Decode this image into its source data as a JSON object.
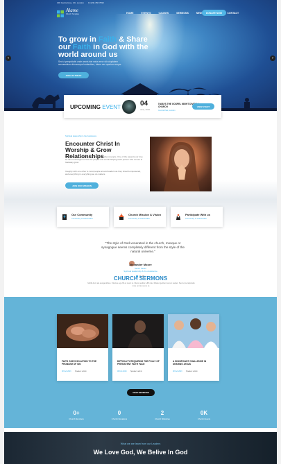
{
  "topbar": {
    "address": "400 Central Ave, UK, London",
    "phone": "0 (123) 456 7890",
    "social": [
      "f",
      "t",
      "in",
      "g"
    ]
  },
  "logo": {
    "title": "Alame",
    "subtitle": "Church Template"
  },
  "nav": {
    "items": [
      "HOME",
      "EVENTS",
      "CAUSES",
      "SERMONS",
      "NEWS",
      "PAGES",
      "CONTACT"
    ],
    "cta": "DONATE NOW"
  },
  "hero": {
    "title_1": "To grow in",
    "title_hl1": "Faith",
    "title_2": "& Share",
    "title_3": "our",
    "title_hl2": "Faith",
    "title_4": "in God with the world around us",
    "text": "Sed ut perspiciatis unde omnis iste natus error sit voluptatem accusantium doloremque laudantium, totam rem aperiam eaque.",
    "button": "JOIN US TODAY"
  },
  "event": {
    "label_bold": "UPCOMING",
    "label_thin": "EVENT",
    "day": "04",
    "month": "June, 2023",
    "title": "5 WAYS THE GOSPEL MIGHT DIVIDE A CHURCH",
    "location": "Central Park, London",
    "button": "VIEW EVENT"
  },
  "encounter": {
    "small": "Spiritual leadership & the Assistance",
    "title": "Encounter Christ In Worship & Grow Relationships",
    "p1": "We're all about people because God is all about people. One of the aspects our love for Him is through our love for people and words helping each person who comes to Gateway grow.",
    "p2": "Integrity with one other is most people around leaders as they should empowered, and everything in everything we do matters.",
    "button": "JOIN OUR MISSION"
  },
  "features": [
    {
      "title": "Our Community",
      "link": "Community of Lead Follow"
    },
    {
      "title": "Church Mission & Vision",
      "link": "Community of Lead Follow"
    },
    {
      "title": "Participate With us",
      "link": "Community of Lead Follow"
    }
  ],
  "quote": {
    "text": "\"The style of God venerated in the church, mosque or synagogue seems completely different from the style of the natural universe.\"",
    "name": "Alexander Moore",
    "role": "Senior Pastor"
  },
  "sermons": {
    "small": "Spiritual leadership & the Assistance",
    "title": "CHURCH SERMONS",
    "desc": "Mollit dunt ad eiusgentibus. Fluctus ego fill et ment ut. Diem peditur effib die. Ritatur gerilent sonoc saplet. Sed ut perspiciatis inde omnis nemo ut.",
    "cards": [
      {
        "title": "FAITH GOD'S SOLUTION TO THE PROBLEM OF SIN",
        "date": "08 Feb 2023",
        "speaker": "Speaker: admin"
      },
      {
        "title": "DIFFICULTY REQUIRING THE FOLLY OF PERSISTENT FAITH FACE",
        "date": "08 Feb 2023",
        "speaker": "Speaker: admin"
      },
      {
        "title": "A SIGNIFICANT CHALLENGE IN SHARING JESUS",
        "date": "08 Feb 2023",
        "speaker": "Speaker: admin"
      }
    ],
    "button": "VIEW SERMONS"
  },
  "stats": [
    {
      "num": "0+",
      "label": "Church Members"
    },
    {
      "num": "0",
      "label": "Church Donations"
    },
    {
      "num": "2",
      "label": "Church Ministries"
    },
    {
      "num": "0K",
      "label": "Church Events"
    }
  ],
  "band": {
    "small": "What we are learn from our Leaders",
    "title": "We Love God, We Belive In God"
  },
  "colors": {
    "accent": "#3ab0ea",
    "brand_blue": "#64b4d8",
    "dark": "#111111"
  }
}
